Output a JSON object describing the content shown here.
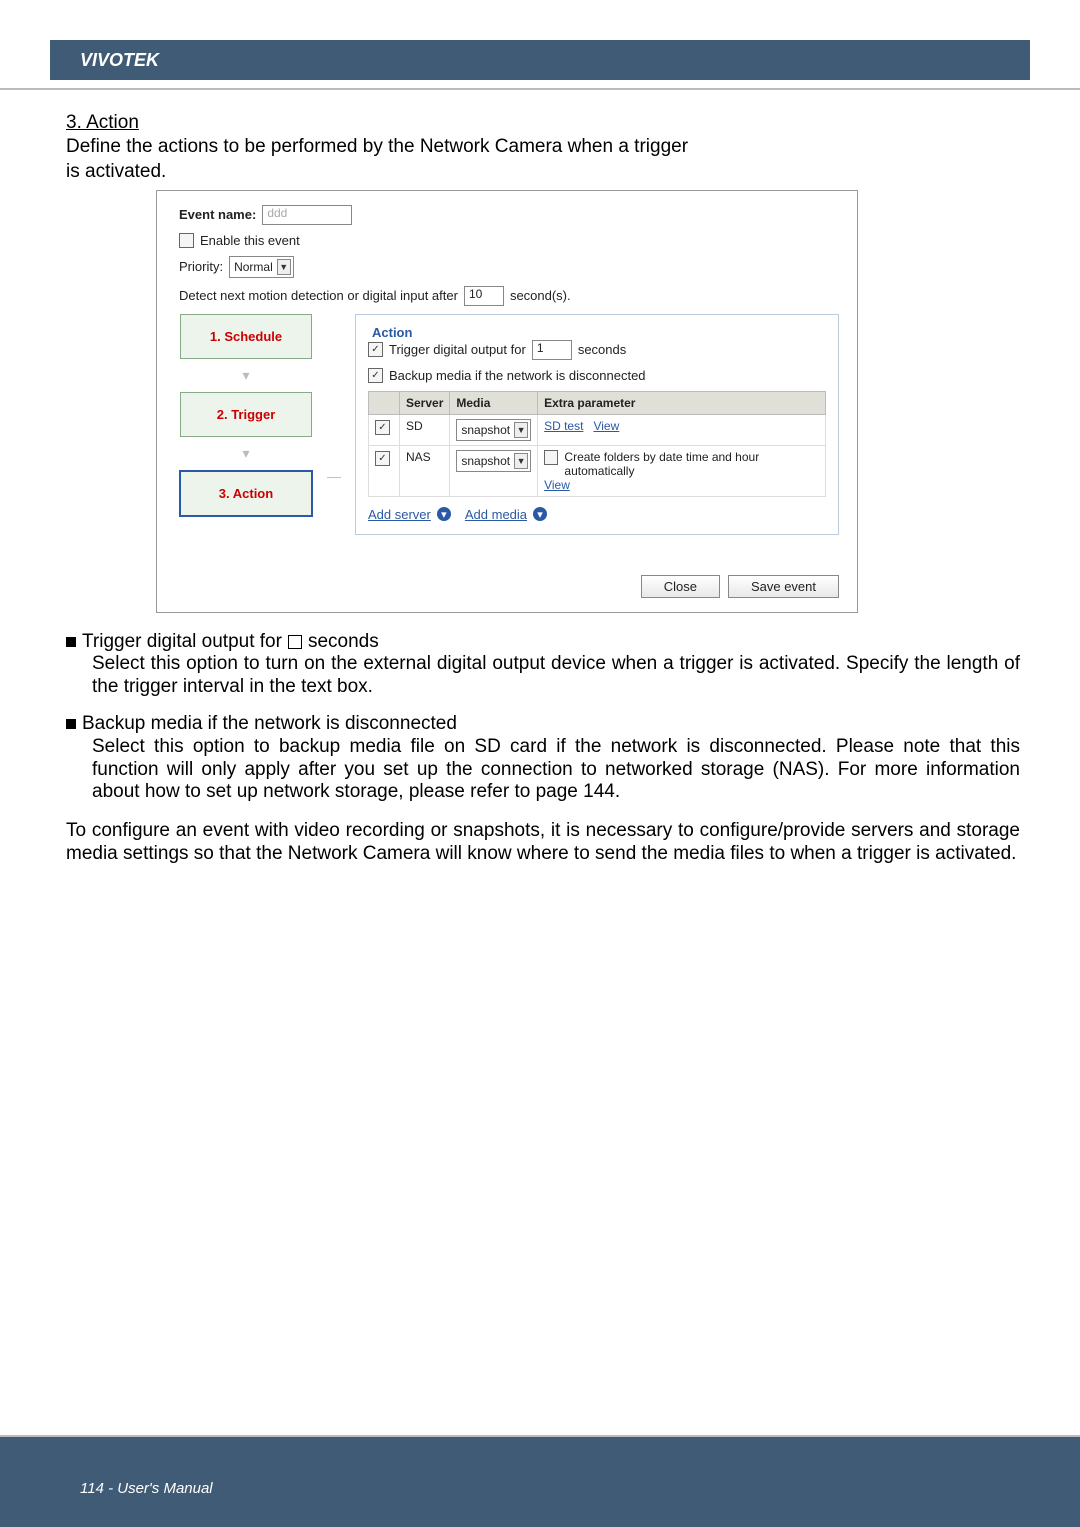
{
  "brand": "VIVOTEK",
  "section": {
    "number_title": "3. Action",
    "desc1": "Define the actions to be performed by the Network Camera when a trigger",
    "desc2": "is activated."
  },
  "cfg": {
    "event_name_label": "Event name:",
    "event_name_value": "ddd",
    "enable_label": "Enable this event",
    "priority_label": "Priority:",
    "priority_value": "Normal",
    "detect_label_a": "Detect next motion detection or digital input after",
    "detect_value": "10",
    "detect_label_b": "second(s).",
    "fieldset_title": "Action",
    "trigger_do_a": "Trigger digital output for",
    "trigger_do_value": "1",
    "trigger_do_b": "seconds",
    "backup_label": "Backup media if the network is disconnected",
    "th_server": "Server",
    "th_media": "Media",
    "th_extra": "Extra parameter",
    "row_sd_server": "SD",
    "row_sd_media": "snapshot",
    "row_sd_sdtest": "SD test",
    "row_sd_view": "View",
    "row_nas_server": "NAS",
    "row_nas_media": "snapshot",
    "row_nas_create": "Create folders by date time and hour automatically",
    "row_nas_view": "View",
    "add_server": "Add server",
    "add_media": "Add media",
    "close": "Close",
    "save": "Save event"
  },
  "steps": {
    "s1": "1.  Schedule",
    "s2": "2.  Trigger",
    "s3": "3.  Action"
  },
  "bullets": {
    "b1_title_a": "Trigger digital output for",
    "b1_title_b": "seconds",
    "b1_body": "Select this option to turn on the external digital output device when a trigger is activated. Specify the length of the trigger interval in the text box.",
    "b2_title": "Backup media if the network is disconnected",
    "b2_body": "Select this option to backup media file on SD card if the network is disconnected. Please note that this function will only apply after you set up the connection to networked storage (NAS). For more information about how to set up network storage, please refer to page 144."
  },
  "para": "To configure an event with video recording or snapshots, it is necessary to configure/provide servers and storage media settings so that the Network Camera will know where to send the media files to when a trigger is activated.",
  "footer": "114 - User's Manual"
}
